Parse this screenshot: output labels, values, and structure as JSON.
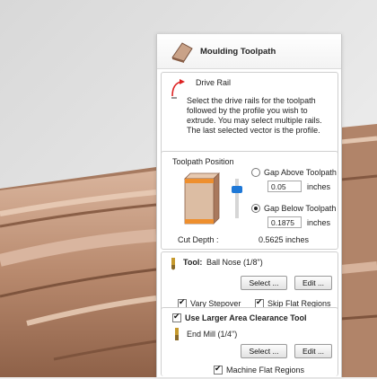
{
  "panel": {
    "title": "Moulding Toolpath"
  },
  "drive_rail": {
    "heading": "Drive Rail",
    "description_lines": [
      "Select the drive rails for the toolpath",
      "followed by the profile you wish to",
      "extrude. You may select multiple rails.",
      "The last selected vector is the profile."
    ]
  },
  "toolpath_position": {
    "heading": "Toolpath Position",
    "gap_above_label": "Gap Above Toolpath",
    "gap_above_value": "0.05",
    "gap_below_label": "Gap Below Toolpath",
    "gap_below_value": "0.1875",
    "units": "inches",
    "selected": "gap_below",
    "cut_depth_label": "Cut Depth :",
    "cut_depth_value": "0.5625 inches"
  },
  "tool": {
    "label": "Tool:",
    "name": "Ball Nose (1/8\")",
    "select_label": "Select ...",
    "edit_label": "Edit ...",
    "vary_stepover_label": "Vary Stepover",
    "vary_stepover_checked": true,
    "skip_flat_label": "Skip Flat Regions",
    "skip_flat_checked": true
  },
  "clearance": {
    "label": "Use Larger Area Clearance Tool",
    "checked": true,
    "tool_name": "End Mill (1/4\")",
    "select_label": "Select ...",
    "edit_label": "Edit ...",
    "machine_flat_label": "Machine Flat Regions",
    "machine_flat_checked": true
  },
  "colors": {
    "wood_light": "#c9a288",
    "wood_dark": "#8a5f47",
    "accent_blue": "#1e78d7",
    "background": "#f0f0f0"
  }
}
